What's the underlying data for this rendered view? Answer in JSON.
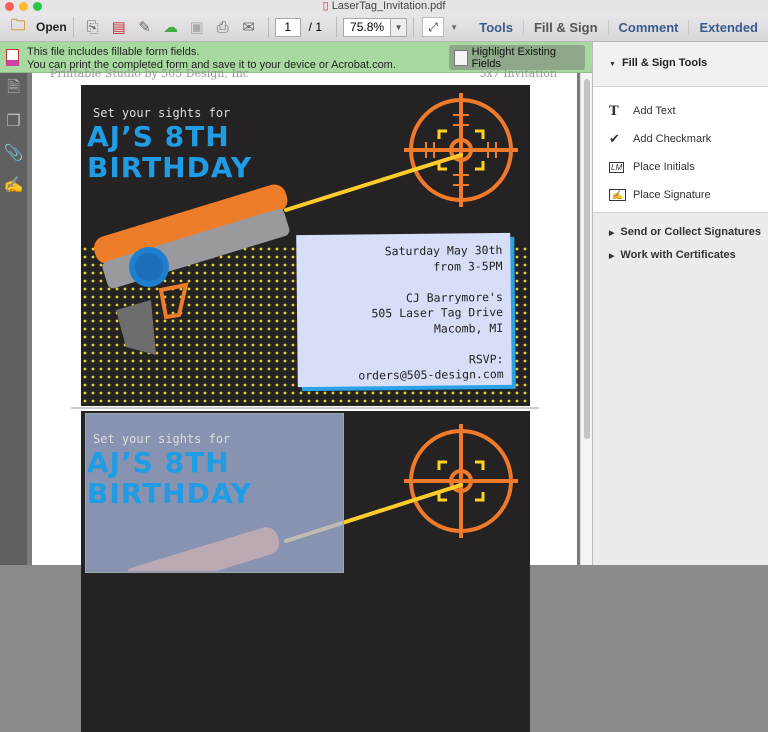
{
  "window": {
    "title": "LaserTag_Invitation.pdf"
  },
  "toolbar": {
    "open_label": "Open",
    "page_current": "1",
    "page_total": "/ 1",
    "zoom": "75.8%",
    "nav": [
      "Tools",
      "Fill & Sign",
      "Comment",
      "Extended"
    ]
  },
  "banner": {
    "line1": "This file includes fillable form fields.",
    "line2": "You can print the completed form and save it to your device or Acrobat.com.",
    "button": "Highlight Existing Fields"
  },
  "page": {
    "header_left": "Printable Studio by 505 Design, Inc",
    "header_right": "5x7 Invitation"
  },
  "invitation": {
    "tagline": "Set your sights for",
    "title_line1": "AJ’S 8TH",
    "title_line2": "BIRTHDAY",
    "details": [
      "Saturday May 30th",
      "from 3-5PM",
      "",
      "CJ Barrymore's",
      "505 Laser Tag Drive",
      "Macomb, MI",
      "",
      "RSVP:",
      "orders@505-design.com"
    ]
  },
  "right_panel": {
    "section": "Fill & Sign Tools",
    "tools": [
      {
        "label": "Add Text",
        "icon": "text-T-icon"
      },
      {
        "label": "Add Checkmark",
        "icon": "checkmark-icon"
      },
      {
        "label": "Place Initials",
        "icon": "initials-icon"
      },
      {
        "label": "Place Signature",
        "icon": "signature-icon"
      }
    ],
    "sections": [
      "Send or Collect Signatures",
      "Work with Certificates"
    ]
  },
  "colors": {
    "accent_blue": "#1f9ce4",
    "target_orange": "#f07a2a",
    "banner_green": "#a8d9a0"
  }
}
